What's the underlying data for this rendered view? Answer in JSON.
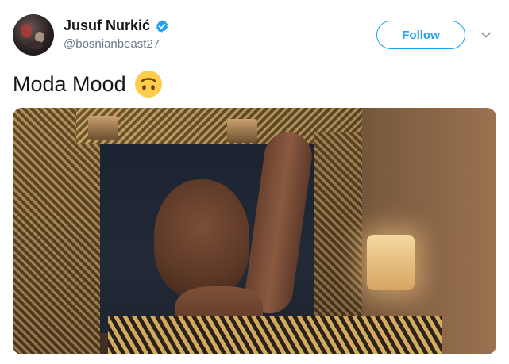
{
  "user": {
    "display_name": "Jusuf Nurkić",
    "handle": "@bosnianbeast27",
    "verified_icon": "verified-badge-icon",
    "avatar_icon": "avatar"
  },
  "follow": {
    "label": "Follow"
  },
  "menu": {
    "icon": "chevron-down-icon"
  },
  "tweet": {
    "text": "Moda Mood",
    "emoji": "upside-down-face-emoji"
  },
  "media": {
    "type": "gif-image"
  },
  "colors": {
    "accent": "#1da1f2",
    "text": "#14171a",
    "secondary": "#657786"
  }
}
